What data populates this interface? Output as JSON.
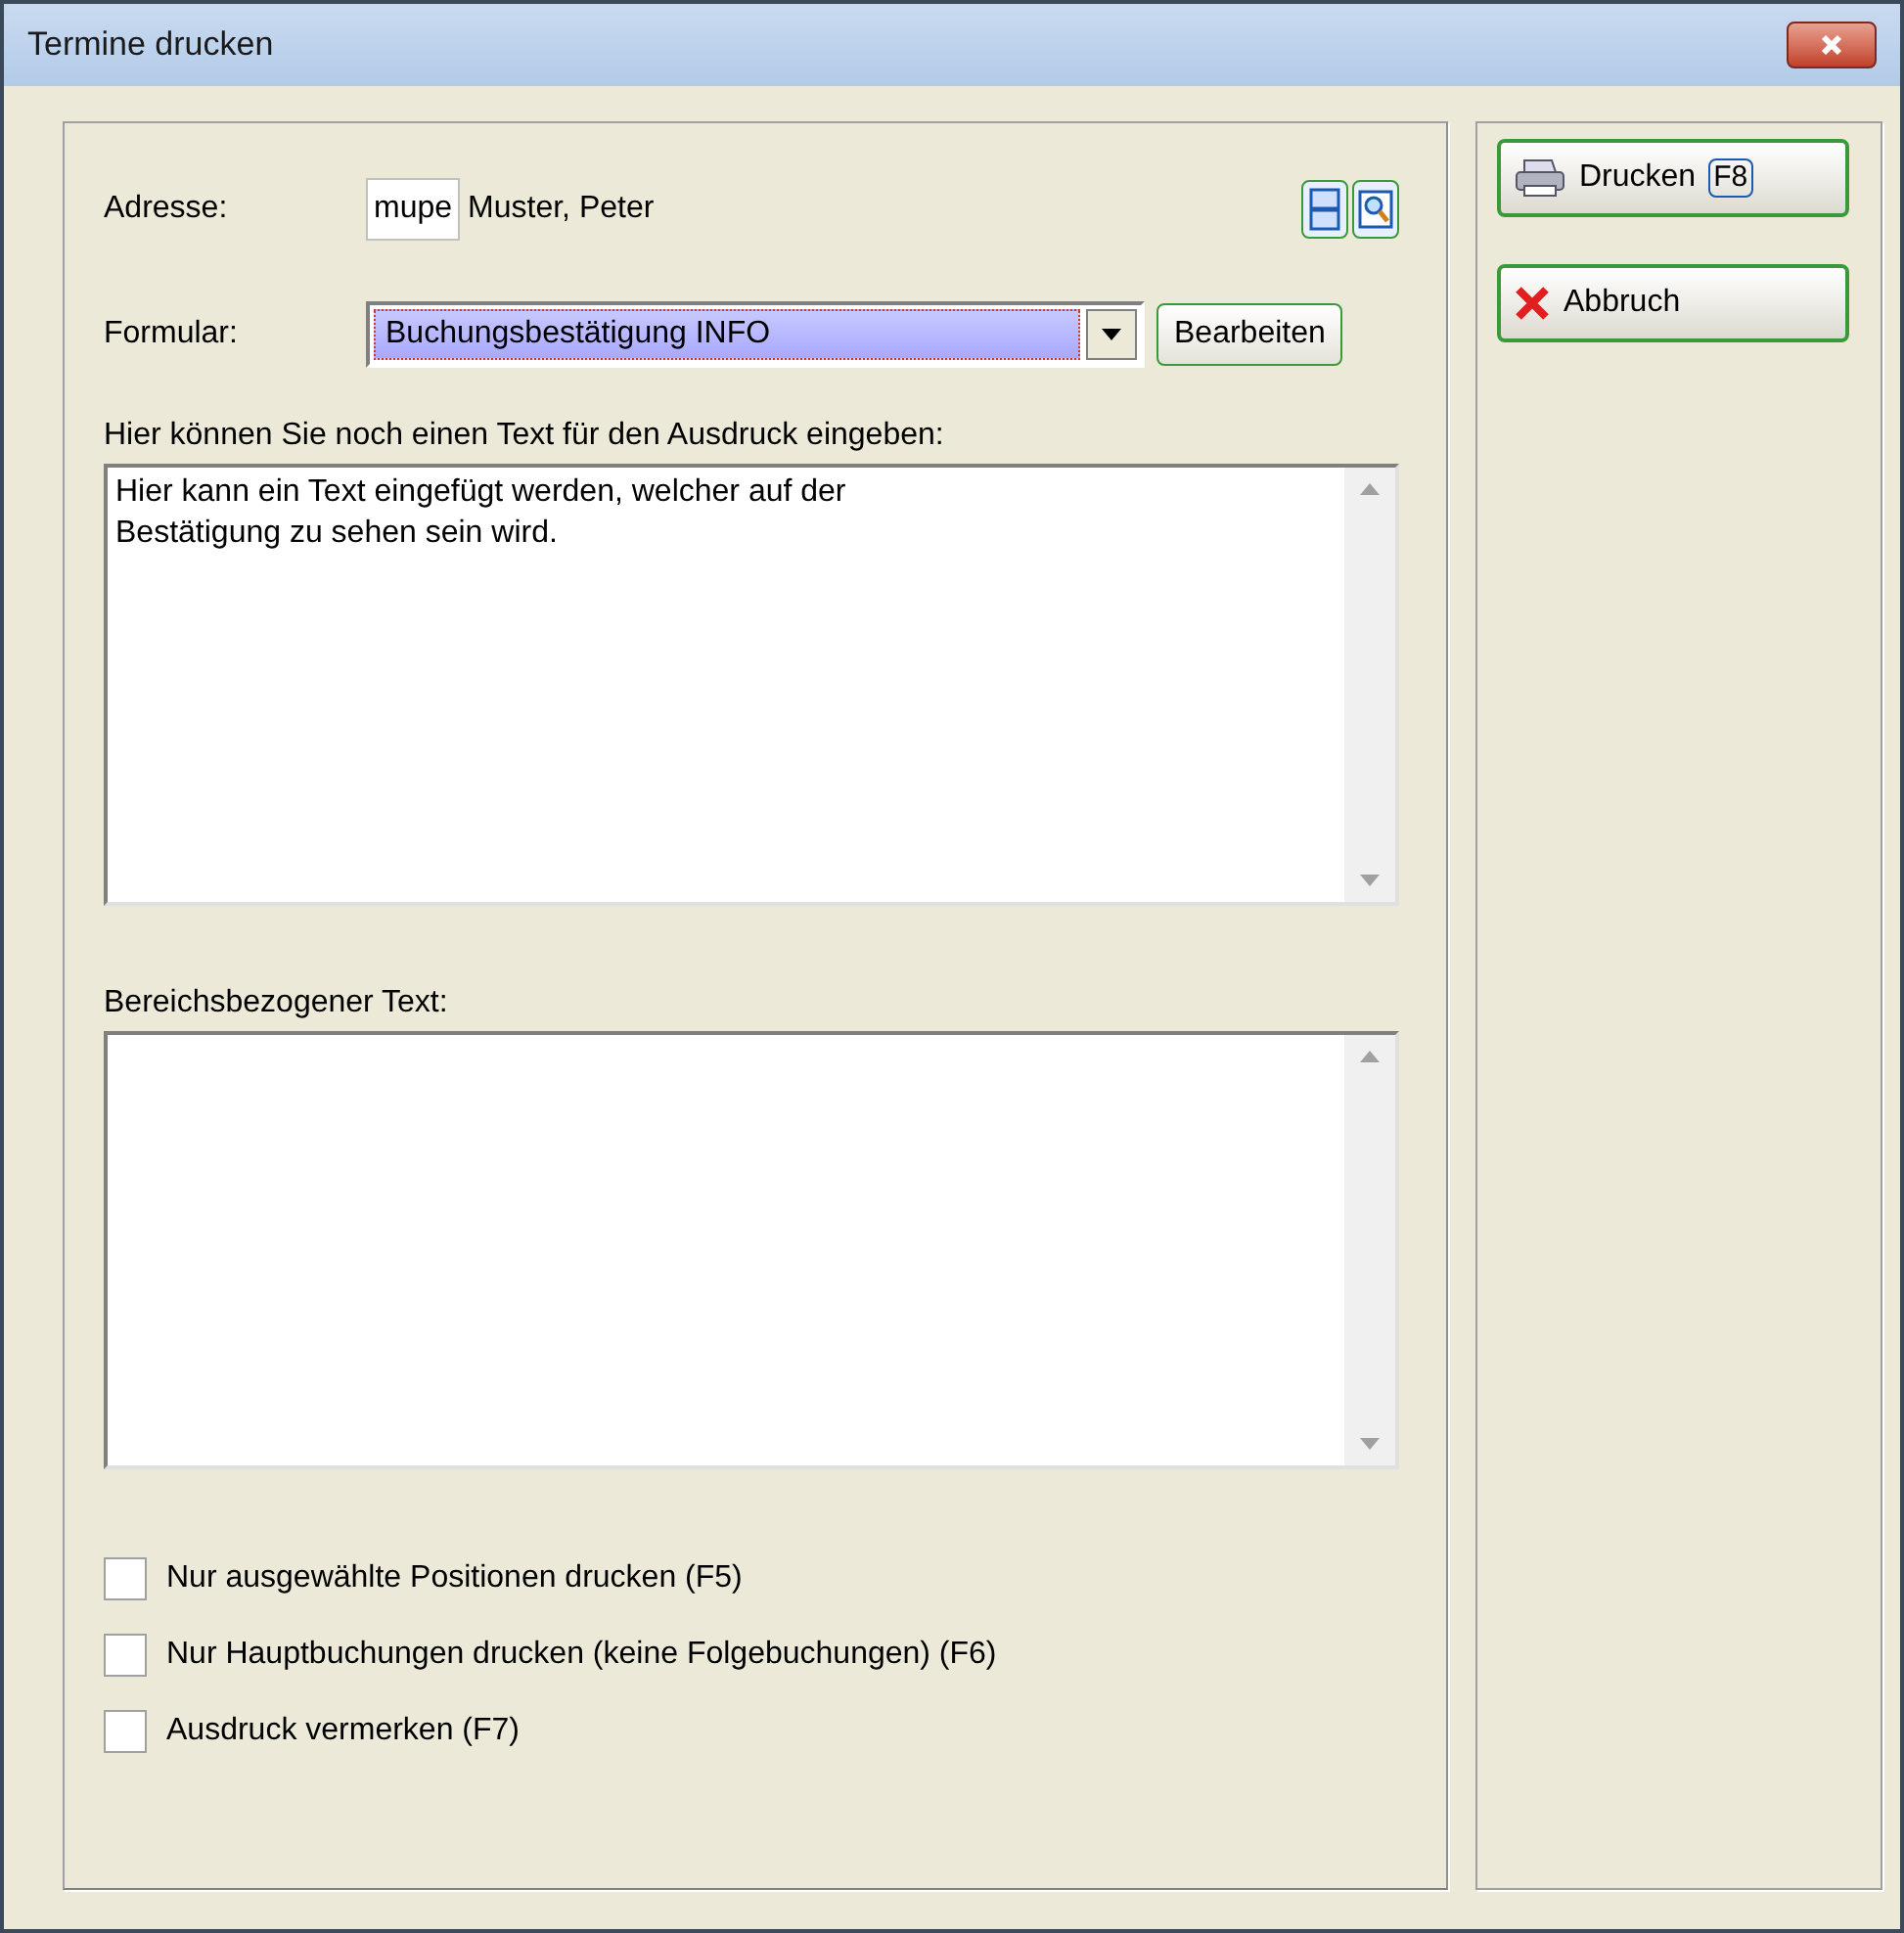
{
  "window": {
    "title": "Termine drucken"
  },
  "address": {
    "label": "Adresse:",
    "code": "mupe",
    "name": "Muster, Peter"
  },
  "form": {
    "label": "Formular:",
    "value": "Buchungsbestätigung INFO",
    "edit_button": "Bearbeiten"
  },
  "note": {
    "label": "Hier können Sie noch einen Text für den Ausdruck eingeben:",
    "value": "Hier kann ein Text eingefügt werden, welcher auf der\nBestätigung zu sehen sein wird."
  },
  "area_text": {
    "label": "Bereichsbezogener Text:"
  },
  "options": [
    {
      "label": "Nur ausgewählte Positionen drucken (F5)",
      "checked": false
    },
    {
      "label": "Nur Hauptbuchungen drucken (keine Folgebuchungen) (F6)",
      "checked": false
    },
    {
      "label": "Ausdruck vermerken (F7)",
      "checked": false
    }
  ],
  "buttons": [
    {
      "kind": "print",
      "label": "Drucken",
      "key": "F8"
    },
    {
      "kind": "cancel",
      "label": "Abbruch"
    }
  ]
}
